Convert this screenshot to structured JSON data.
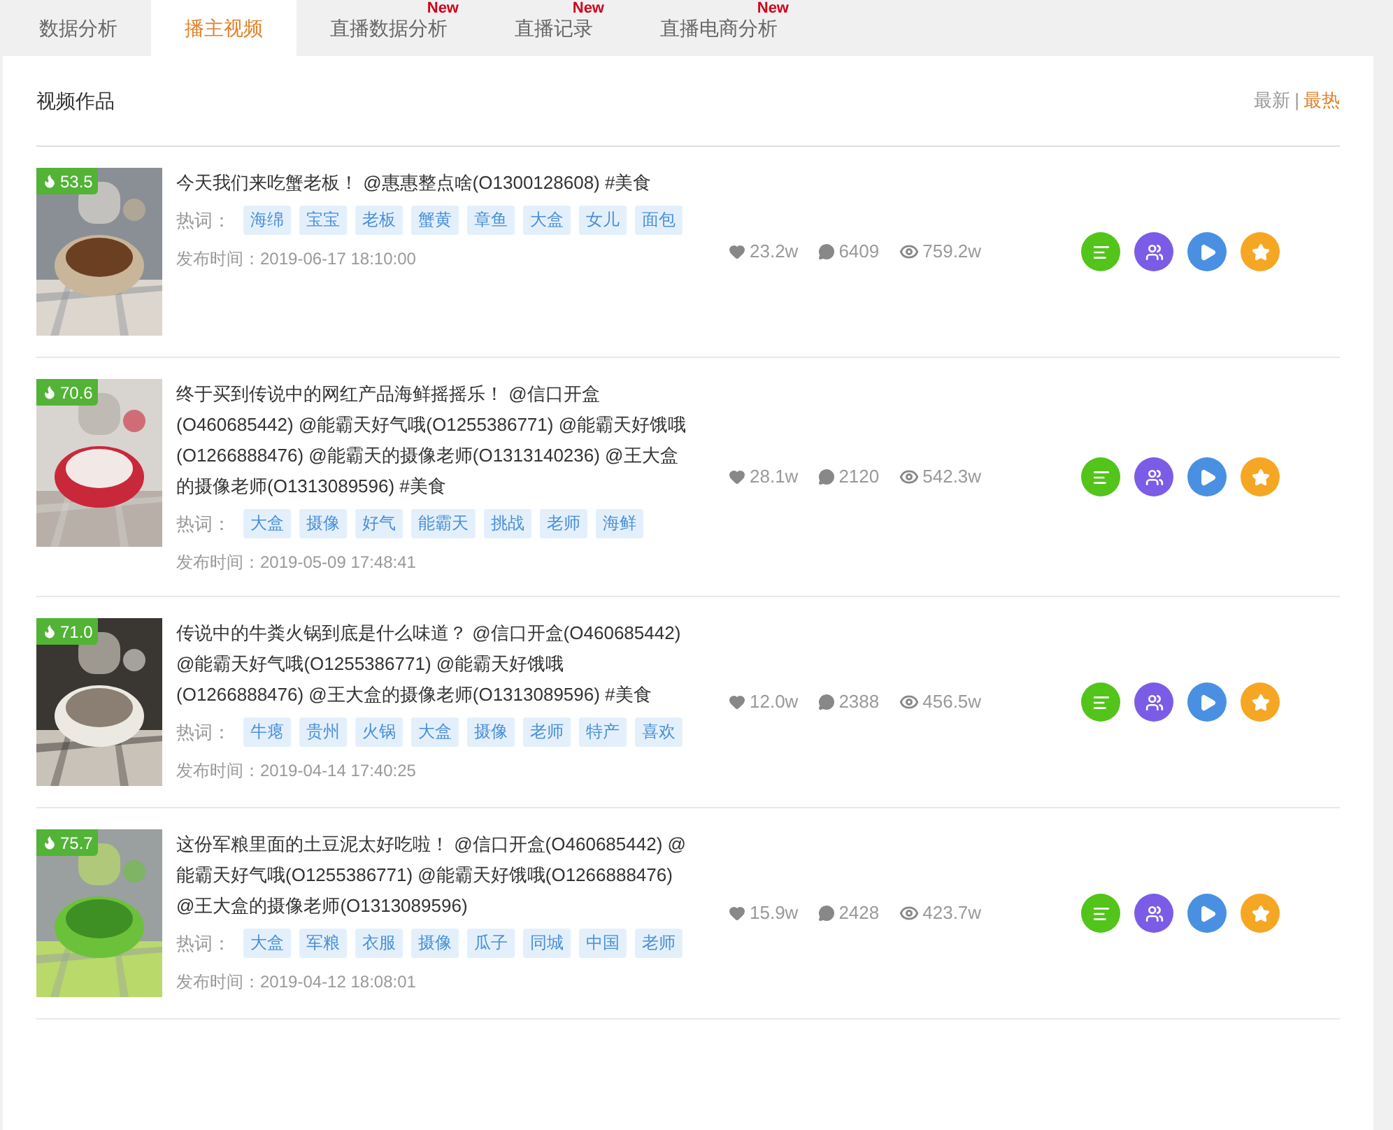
{
  "tabs": [
    {
      "label": "数据分析",
      "selected": false
    },
    {
      "label": "播主视频",
      "selected": true
    },
    {
      "label": "直播数据分析",
      "selected": false,
      "badge": "New"
    },
    {
      "label": "直播记录",
      "selected": false,
      "badge": "New"
    },
    {
      "label": "直播电商分析",
      "selected": false,
      "badge": "New"
    }
  ],
  "section_title": "视频作品",
  "sort": {
    "options": [
      {
        "label": "最新",
        "selected": false
      },
      {
        "label": "最热",
        "selected": true
      }
    ],
    "separator": "|"
  },
  "videos": [
    {
      "score": "53.5",
      "title": "今天我们来吃蟹老板！ @惠惠整点啥(O1300128608) #美食",
      "hot_words_label": "热词：",
      "hot_words": [
        "海绵",
        "宝宝",
        "老板",
        "蟹黄",
        "章鱼",
        "大盒",
        "女儿",
        "面包"
      ],
      "published": "发布时间：2019-06-17 18:10:00",
      "likes": "23.2w",
      "comments": "6409",
      "views": "759.2w"
    },
    {
      "score": "70.6",
      "title": "终于买到传说中的网红产品海鲜摇摇乐！ @信口开盒(O460685442) @能霸天好气哦(O1255386771) @能霸天好饿哦(O1266888476) @能霸天的摄像老师(O1313140236) @王大盒的摄像老师(O1313089596) #美食",
      "hot_words_label": "热词：",
      "hot_words": [
        "大盒",
        "摄像",
        "好气",
        "能霸天",
        "挑战",
        "老师",
        "海鲜"
      ],
      "published": "发布时间：2019-05-09 17:48:41",
      "likes": "28.1w",
      "comments": "2120",
      "views": "542.3w"
    },
    {
      "score": "71.0",
      "title": "传说中的牛粪火锅到底是什么味道？ @信口开盒(O460685442) @能霸天好气哦(O1255386771) @能霸天好饿哦(O1266888476) @王大盒的摄像老师(O1313089596) #美食",
      "hot_words_label": "热词：",
      "hot_words": [
        "牛瘪",
        "贵州",
        "火锅",
        "大盒",
        "摄像",
        "老师",
        "特产",
        "喜欢"
      ],
      "published": "发布时间：2019-04-14 17:40:25",
      "likes": "12.0w",
      "comments": "2388",
      "views": "456.5w"
    },
    {
      "score": "75.7",
      "title": "这份军粮里面的土豆泥太好吃啦！ @信口开盒(O460685442) @能霸天好气哦(O1255386771) @能霸天好饿哦(O1266888476) @王大盒的摄像老师(O1313089596)",
      "hot_words_label": "热词：",
      "hot_words": [
        "大盒",
        "军粮",
        "衣服",
        "摄像",
        "瓜子",
        "同城",
        "中国",
        "老师"
      ],
      "published": "发布时间：2019-04-12 18:08:01",
      "likes": "15.9w",
      "comments": "2428",
      "views": "423.7w"
    }
  ]
}
